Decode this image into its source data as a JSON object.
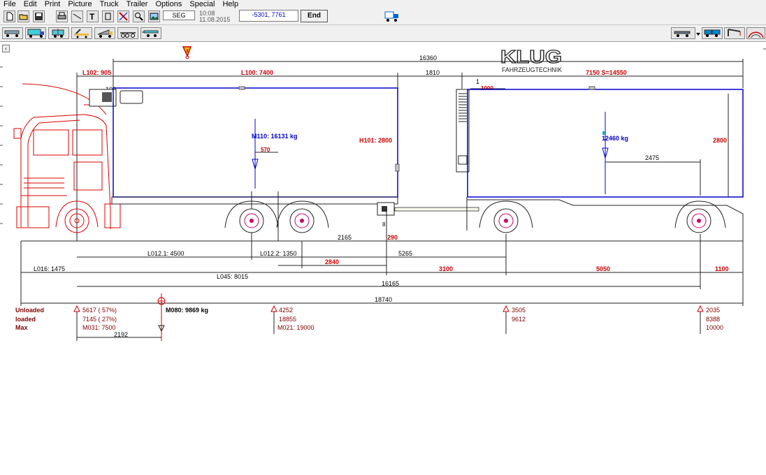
{
  "menu": [
    "File",
    "Edit",
    "Print",
    "Picture",
    "Truck",
    "Trailer",
    "Options",
    "Special",
    "Help"
  ],
  "toolbar": {
    "mode_field": "SEG",
    "time": "10:08",
    "date": "11.08.2015",
    "coordinates": "-5301, 7761",
    "end_label": "End"
  },
  "logo": {
    "name": "KLUG",
    "tagline": "FAHRZEUGTECHNIK"
  },
  "colors": {
    "dimension_red": "#cc0000",
    "body_blue": "#0000cc",
    "text_dark_red": "#800000",
    "cab_red": "#dd0000"
  },
  "dims": {
    "overall_length": "16360",
    "l102": "L102: 905",
    "l100": "L100: 7400",
    "gap": "1810",
    "trailer_body": "7150  S=14550",
    "trailer_front_marker": "1",
    "trailer_front_offset": "1000",
    "truck_top_offset": "100",
    "h101": "H101: 2800",
    "trailer_height": "2800",
    "m110": "M110: 16131 kg",
    "m110_offset": "570",
    "trailer_load": "12460 kg",
    "trailer_load_offset": "2475",
    "coupling_label": "8",
    "d2165": "2165",
    "d290": "290",
    "l0121": "L012.1: 4500",
    "l0122": "L012.2: 1350",
    "d5265": "5265",
    "d2840": "2840",
    "l016": "L016: 1475",
    "d3100": "3100",
    "d5050": "5050",
    "d1100": "1100",
    "l045": "L045: 8015",
    "d16165": "16165",
    "d18740": "18740"
  },
  "loads": {
    "labels": {
      "unloaded": "Unloaded",
      "loaded": "loaded",
      "max": "Max"
    },
    "m080": "M080:  9869 kg",
    "d2192": "2192",
    "axle1": {
      "unloaded": "5617 ( 57%)",
      "loaded": "7145 ( 27%)",
      "max": "M031: 7500"
    },
    "axle2": {
      "unloaded": "4252",
      "loaded": "18855",
      "max": "M021: 19000"
    },
    "axle3": {
      "unloaded": "3505",
      "loaded": "9612"
    },
    "axle4": {
      "unloaded": "2035",
      "loaded": "8388",
      "max": "10000"
    }
  }
}
